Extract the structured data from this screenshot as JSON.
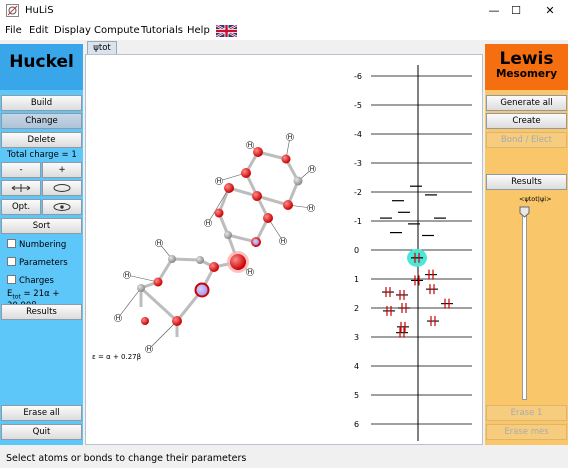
{
  "window": {
    "title": "HuLiS",
    "minimize_glyph": "—",
    "maximize_glyph": "☐",
    "close_glyph": "✕"
  },
  "menu": {
    "items": [
      "File",
      "Edit",
      "Display",
      "Compute",
      "Tutorials",
      "Help"
    ],
    "flag_icon": "uk-flag-icon"
  },
  "left": {
    "header": "Huckel",
    "build": "Build",
    "change": "Change",
    "delete": "Delete",
    "total_charge": "Total charge = 1",
    "minus": "-",
    "plus": "+",
    "opt": "Opt.",
    "sort": "Sort",
    "numbering": "Numbering",
    "parameters": "Parameters",
    "charges": "Charges",
    "etot_prefix": "E",
    "etot_sub": "tot",
    "etot_value": " = 21α + 30.90β",
    "results": "Results",
    "erase_all": "Erase all",
    "quit": "Quit",
    "accent": "#5ec7f9",
    "header_color": "#39a6ea"
  },
  "tab": {
    "label": "ψtot"
  },
  "molecule": {
    "hydrogen_label": "H",
    "energy_caption": "ε = α + 0.27β"
  },
  "diagram": {
    "levels": [
      {
        "label": "-6",
        "value": -6
      },
      {
        "label": "-5",
        "value": -5
      },
      {
        "label": "-4",
        "value": -4
      },
      {
        "label": "-3",
        "value": -3
      },
      {
        "label": "-2",
        "value": -2
      },
      {
        "label": "-1",
        "value": -1
      },
      {
        "label": "0",
        "value": 0
      },
      {
        "label": "1",
        "value": 1
      },
      {
        "label": "2",
        "value": 2
      },
      {
        "label": "3",
        "value": 3
      },
      {
        "label": "4",
        "value": 4
      },
      {
        "label": "5",
        "value": 5
      },
      {
        "label": "6",
        "value": 6
      }
    ]
  },
  "right": {
    "header_line1": "Lewis",
    "header_line2": "Mesomery",
    "generate_all": "Generate all",
    "create": "Create",
    "bond_elect": "Bond / Elect",
    "results": "Results",
    "slider_label": "<ψtot|ψi>",
    "erase1": "Erase 1",
    "erase_mes": "Erase mes",
    "accent": "#f9c76a",
    "header_color": "#f56e0f"
  },
  "status": {
    "text": "Select atoms or bonds to change their parameters"
  }
}
